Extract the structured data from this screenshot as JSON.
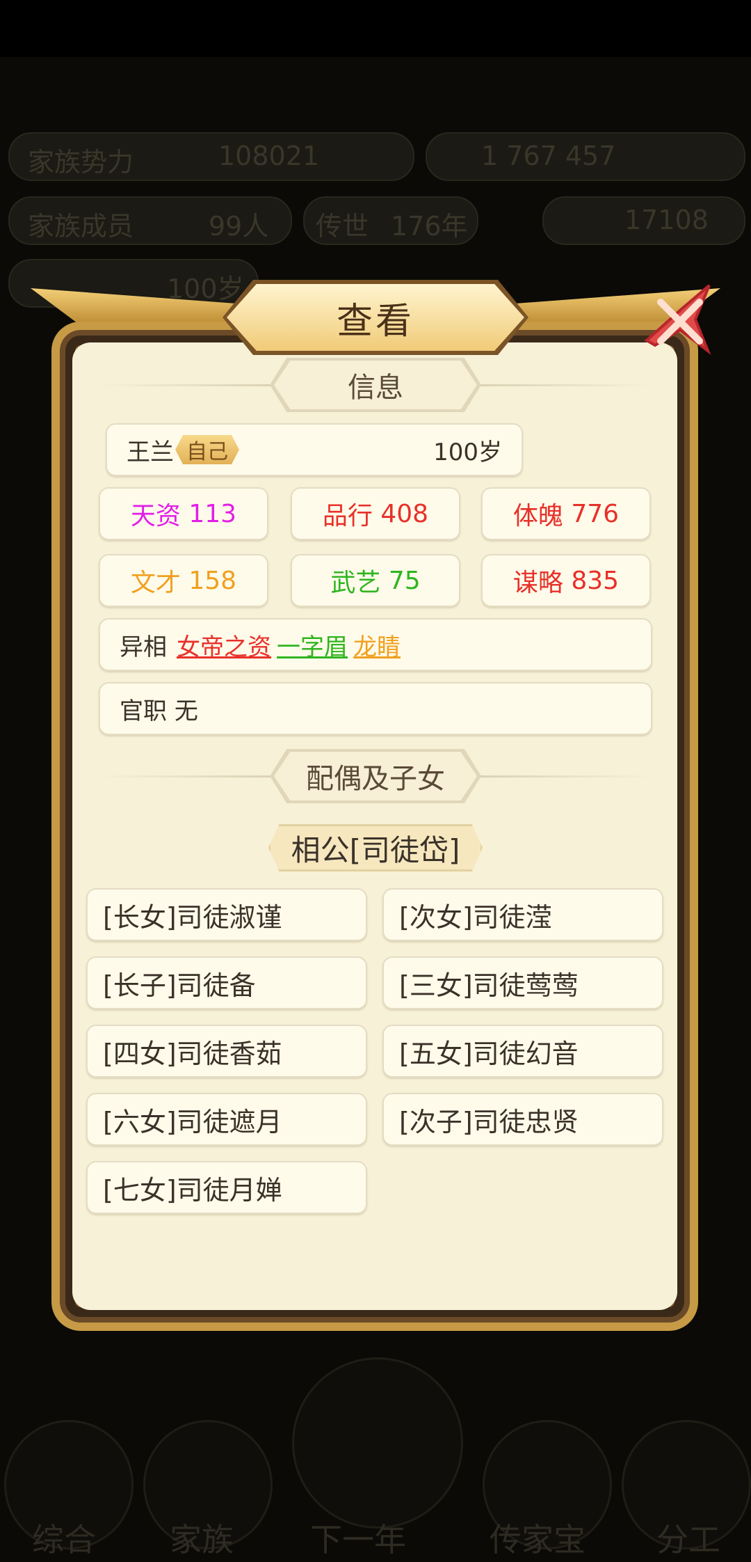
{
  "background": {
    "stats_row1": [
      {
        "label": "家族势力",
        "value": "108021"
      },
      {
        "label": "",
        "value": "1 767 457"
      }
    ],
    "stats_row2": [
      {
        "label": "家族成员",
        "value": "99人"
      },
      {
        "label": "传世",
        "value": "176年"
      },
      {
        "label": "",
        "value": "17108"
      }
    ],
    "age_hint": "100岁",
    "nav": [
      "综合",
      "家族",
      "下一年",
      "传家宝",
      "分工"
    ]
  },
  "dialog": {
    "title": "查看",
    "info_header": "信息",
    "name": "王兰",
    "self_badge": "自己",
    "age": "100岁",
    "stats": [
      {
        "label": "天资",
        "value": "113",
        "color": "#e21ee8"
      },
      {
        "label": "品行",
        "value": "408",
        "color": "#e8302a"
      },
      {
        "label": "体魄",
        "value": "776",
        "color": "#e8302a"
      },
      {
        "label": "文才",
        "value": "158",
        "color": "#f0a020"
      },
      {
        "label": "武艺",
        "value": "75",
        "color": "#2fb51f"
      },
      {
        "label": "谋略",
        "value": "835",
        "color": "#e8302a"
      }
    ],
    "traits_label": "异相",
    "traits": [
      {
        "text": "女帝之资",
        "color": "#e8302a"
      },
      {
        "text": "一字眉",
        "color": "#2fb51f"
      },
      {
        "text": "龙睛",
        "color": "#f0a020"
      }
    ],
    "office_label": "官职",
    "office_value": "无",
    "family_header": "配偶及子女",
    "spouse": "相公[司徒岱]",
    "children": [
      "[长女]司徒淑谨",
      "[次女]司徒滢",
      "[长子]司徒备",
      "[三女]司徒莺莺",
      "[四女]司徒香茹",
      "[五女]司徒幻音",
      "[六女]司徒遮月",
      "[次子]司徒忠贤",
      "[七女]司徒月婵"
    ]
  }
}
